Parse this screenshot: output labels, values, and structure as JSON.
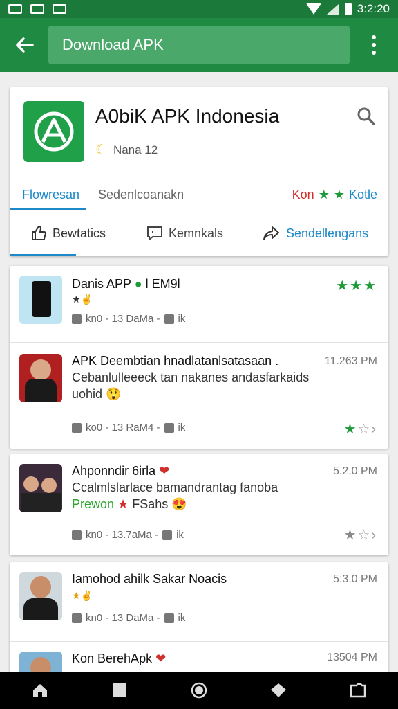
{
  "status": {
    "time": "3:2:20"
  },
  "appbar": {
    "search_value": "Download APK"
  },
  "header": {
    "app_title": "A0biK APK Indonesia",
    "author": "Nana 12",
    "tabs": {
      "active": "Flowresan",
      "second": "Sedenlcoanakn",
      "right_red": "Kon",
      "right_blue": "Kotle"
    },
    "actions": {
      "a1": "Bewtatics",
      "a2": "Kemnkals",
      "a3": "Sendellengans"
    }
  },
  "feed": [
    {
      "title": "Danis APP",
      "tag": "l EM9l",
      "meta": "kn0 - 13 DaMa - ",
      "suffix": "ik"
    },
    {
      "title": "APK Deembtian hnadlatanlsatasaan .",
      "line2": "Cebanlulleeeck tan nakanes andasfarkaids",
      "line3": "uohid",
      "time": "11.263 PM",
      "meta": "ko0 - 13 RaM4 - ",
      "suffix": "ik"
    },
    {
      "title": "Ahponndir 6irla",
      "line2": "Ccalmlslarlace bamandrantag fanoba",
      "green": "Prewon",
      "red_text": "FSahs",
      "time": "5.2.0 PM",
      "meta": "kn0 - 13.7aMa - ",
      "suffix": "ik"
    },
    {
      "title": "Iamohod ahilk Sakar Noacis",
      "time": "5:3.0 PM",
      "meta": "kn0 - 13 DaMa - ",
      "suffix": "ik"
    },
    {
      "title": "Kon BerehApk",
      "time": "13504 PM"
    }
  ],
  "colors": {
    "primary": "#1e8a42",
    "accent": "#1e88c8",
    "star_green": "#1e9a3a"
  }
}
